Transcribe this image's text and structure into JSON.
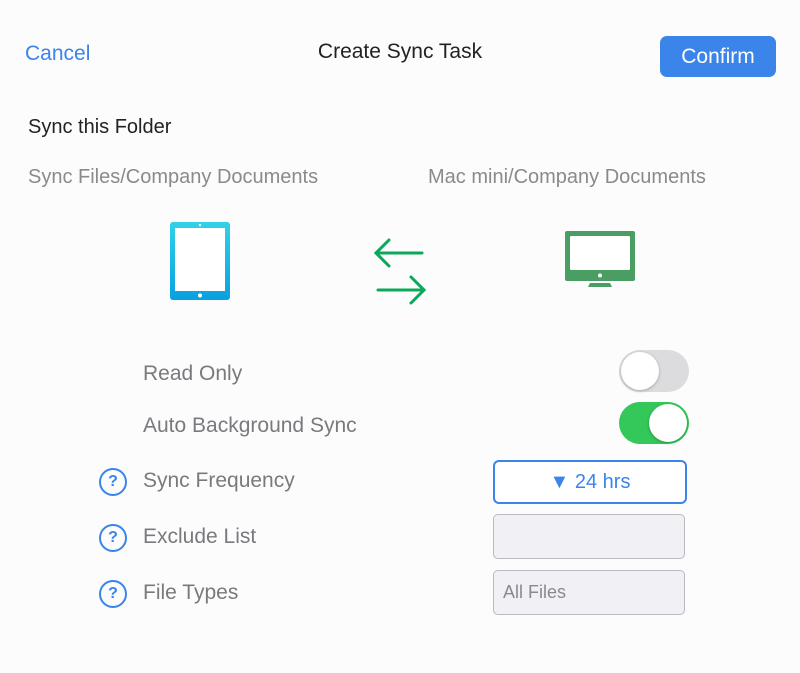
{
  "header": {
    "cancel_label": "Cancel",
    "title": "Create Sync Task",
    "confirm_label": "Confirm"
  },
  "section": {
    "title": "Sync this Folder",
    "source_path": "Sync Files/Company Documents",
    "destination_path": "Mac mini/Company Documents",
    "source_icon": "ipad-icon",
    "sync_icon": "bidirectional-arrows-icon",
    "destination_icon": "desktop-computer-icon"
  },
  "options": {
    "read_only": {
      "label": "Read Only",
      "enabled": false
    },
    "auto_background_sync": {
      "label": "Auto Background Sync",
      "enabled": true
    },
    "sync_frequency": {
      "label": "Sync Frequency",
      "value": "▼ 24 hrs",
      "help_icon": "?"
    },
    "exclude_list": {
      "label": "Exclude List",
      "value": "",
      "help_icon": "?"
    },
    "file_types": {
      "label": "File Types",
      "placeholder": "All Files",
      "help_icon": "?"
    }
  },
  "colors": {
    "accent": "#3a84ea",
    "toggle_on": "#34c759",
    "sync_arrows": "#0ba85a",
    "computer": "#4a9e64",
    "tablet": "#1aa8e0"
  }
}
